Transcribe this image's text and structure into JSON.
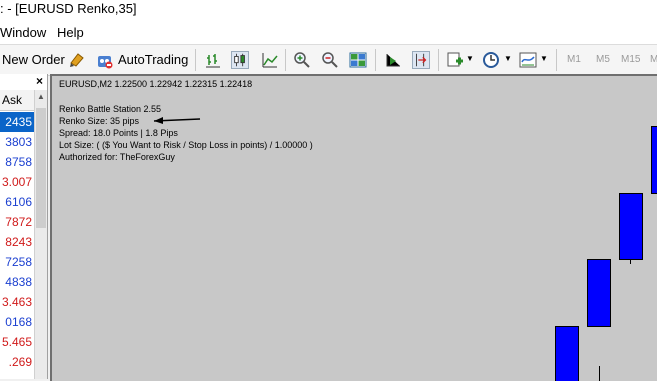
{
  "window": {
    "title": ": - [EURUSD Renko,35]"
  },
  "menu": {
    "window": "Window",
    "help": "Help"
  },
  "toolbar": {
    "new_order": "New Order",
    "autotrading": "AutoTrading",
    "periods": [
      "M1",
      "M5",
      "M15",
      "M"
    ]
  },
  "market_watch": {
    "close": "×",
    "column": "Ask",
    "rows": [
      {
        "value": "2435",
        "color": "#ffffff",
        "selected": true
      },
      {
        "value": "3803",
        "color": "#1a3fd0"
      },
      {
        "value": "8758",
        "color": "#1a3fd0"
      },
      {
        "value": "3.007",
        "color": "#d01a1a"
      },
      {
        "value": "6106",
        "color": "#1a3fd0"
      },
      {
        "value": "7872",
        "color": "#d01a1a"
      },
      {
        "value": "8243",
        "color": "#d01a1a"
      },
      {
        "value": "7258",
        "color": "#1a3fd0"
      },
      {
        "value": "4838",
        "color": "#1a3fd0"
      },
      {
        "value": "3.463",
        "color": "#d01a1a"
      },
      {
        "value": "0168",
        "color": "#1a3fd0"
      },
      {
        "value": "5.465",
        "color": "#d01a1a"
      },
      {
        "value": ".269",
        "color": "#d01a1a"
      }
    ]
  },
  "chart": {
    "header": "EURUSD,M2  1.22500 1.22942 1.22315 1.22418",
    "info": {
      "station": "Renko Battle Station 2.55",
      "renko_size": "Renko Size: 35 pips",
      "spread": "Spread: 18.0 Points | 1.8 Pips",
      "lot_size": "Lot Size: ( ($ You Want to Risk / Stop Loss in points) / 1.00000 )",
      "authorized": "Authorized for: TheForexGuy"
    },
    "candle_color": "#0000ff"
  }
}
